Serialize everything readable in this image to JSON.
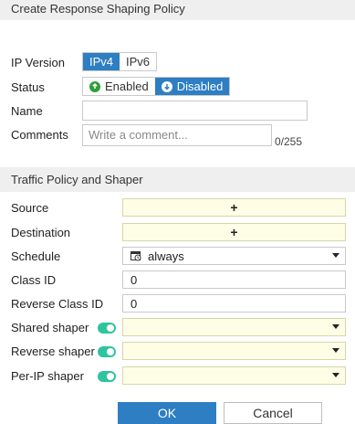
{
  "dialog": {
    "title": "Create Response Shaping Policy"
  },
  "fields": {
    "ip_version": {
      "label": "IP Version",
      "options": [
        "IPv4",
        "IPv6"
      ],
      "selected": "IPv4"
    },
    "status": {
      "label": "Status",
      "enabled_label": "Enabled",
      "disabled_label": "Disabled",
      "selected": "Disabled"
    },
    "name": {
      "label": "Name",
      "value": ""
    },
    "comments": {
      "label": "Comments",
      "placeholder": "Write a comment...",
      "counter": "0/255"
    }
  },
  "traffic_section": {
    "title": "Traffic Policy and Shaper",
    "source": {
      "label": "Source",
      "add_icon": "plus-icon"
    },
    "destination": {
      "label": "Destination",
      "add_icon": "plus-icon"
    },
    "schedule": {
      "label": "Schedule",
      "value": "always",
      "icon": "schedule-icon"
    },
    "class_id": {
      "label": "Class ID",
      "value": "0"
    },
    "reverse_class_id": {
      "label": "Reverse Class ID",
      "value": "0"
    },
    "shared_shaper": {
      "label": "Shared shaper",
      "toggle": true,
      "value": ""
    },
    "reverse_shaper": {
      "label": "Reverse shaper",
      "toggle": true,
      "value": ""
    },
    "per_ip_shaper": {
      "label": "Per-IP shaper",
      "toggle": true,
      "value": ""
    }
  },
  "buttons": {
    "ok": "OK",
    "cancel": "Cancel"
  },
  "colors": {
    "accent": "#2d7ec3",
    "toggle_on": "#2ec4a0",
    "required_bg": "#fefee7"
  }
}
